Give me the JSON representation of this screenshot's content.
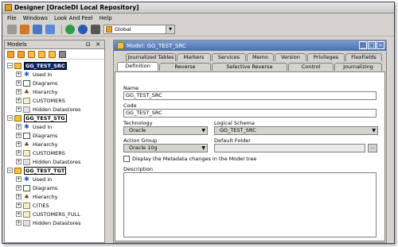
{
  "window": {
    "title": "Designer [OracleDI Local Repository]"
  },
  "menu": [
    "File",
    "Windows",
    "Look And Feel",
    "Help"
  ],
  "toolbar": {
    "context_value": "Global"
  },
  "models_panel": {
    "title": "Models",
    "controls": "⊡ ✕",
    "tree": [
      {
        "label": "GG_TEST_SRC",
        "children": [
          "Used in",
          "Diagrams",
          "Hierarchy",
          "CUSTOMERS",
          "Hidden Datastores"
        ]
      },
      {
        "label": "GG_TEST_STG",
        "children": [
          "Used in",
          "Diagrams",
          "Hierarchy",
          "CUSTOMERS",
          "Hidden Datastores"
        ]
      },
      {
        "label": "GG_TEST_TGT",
        "children": [
          "Used in",
          "Diagrams",
          "Hierarchy",
          "CITIES",
          "CUSTOMERS_FULL",
          "Hidden Datastores"
        ]
      }
    ]
  },
  "editor": {
    "title": "Model: GG_TEST_SRC",
    "tabs_back": [
      "Journalized Tables",
      "Markers",
      "Services",
      "Memo",
      "Version",
      "Privileges",
      "FlexFields"
    ],
    "tabs_front": [
      "Definition",
      "Reverse",
      "Selective Reverse",
      "Control",
      "Journalizing"
    ],
    "active_tab": "Definition",
    "form": {
      "name_label": "Name",
      "name_value": "GG_TEST_SRC",
      "code_label": "Code",
      "code_value": "GG_TEST_SRC",
      "technology_label": "Technology",
      "technology_value": "Oracle",
      "logical_schema_label": "Logical Schema",
      "logical_schema_value": "GG_TEST_SRC",
      "action_group_label": "Action Group",
      "action_group_value": "Oracle 10g",
      "default_folder_label": "Default Folder",
      "default_folder_value": "",
      "display_metadata_label": "Display the Metadata changes in the Model tree",
      "description_label": "Description",
      "description_value": ""
    }
  }
}
